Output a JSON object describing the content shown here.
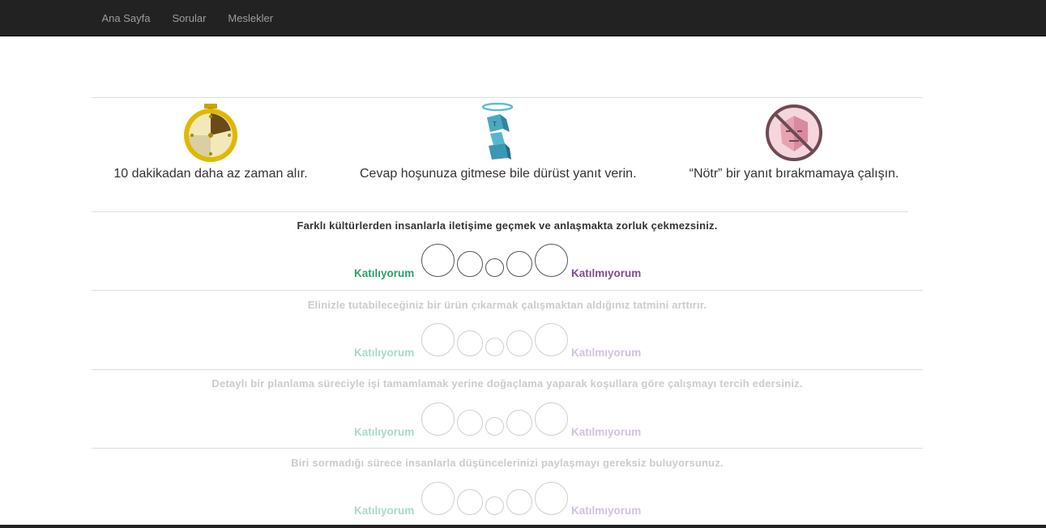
{
  "nav": {
    "items": [
      "Ana Sayfa",
      "Sorular",
      "Meslekler"
    ]
  },
  "tips": [
    {
      "icon": "stopwatch-icon",
      "text": "10 dakikadan daha az zaman alır."
    },
    {
      "icon": "angel-figure-icon",
      "text": "Cevap hoşunuza gitmese bile dürüst yanıt verin."
    },
    {
      "icon": "no-neutral-face-icon",
      "text": "“Nötr” bir yanıt bırakmamaya çalışın."
    }
  ],
  "scale": {
    "agree_label": "Katılıyorum",
    "disagree_label": "Katılmıyorum"
  },
  "colors": {
    "agree": "#2e9e6f",
    "disagree": "#7a4f8c",
    "navbar": "#222222"
  },
  "questions": [
    {
      "text": "Farklı kültürlerden insanlarla iletişime geçmek ve anlaşmakta zorluk çekmezsiniz.",
      "active": true
    },
    {
      "text": "Elinizle tutabileceğiniz bir ürün çıkarmak çalışmaktan aldığınız tatmini arttırır.",
      "active": false
    },
    {
      "text": "Detaylı bir planlama süreciyle işi tamamlamak yerine doğaçlama yaparak koşullara göre çalışmayı tercih edersiniz.",
      "active": false
    },
    {
      "text": "Biri sormadığı sürece insanlarla düşüncelerinizi paylaşmayı gereksiz buluyorsunuz.",
      "active": false
    }
  ]
}
